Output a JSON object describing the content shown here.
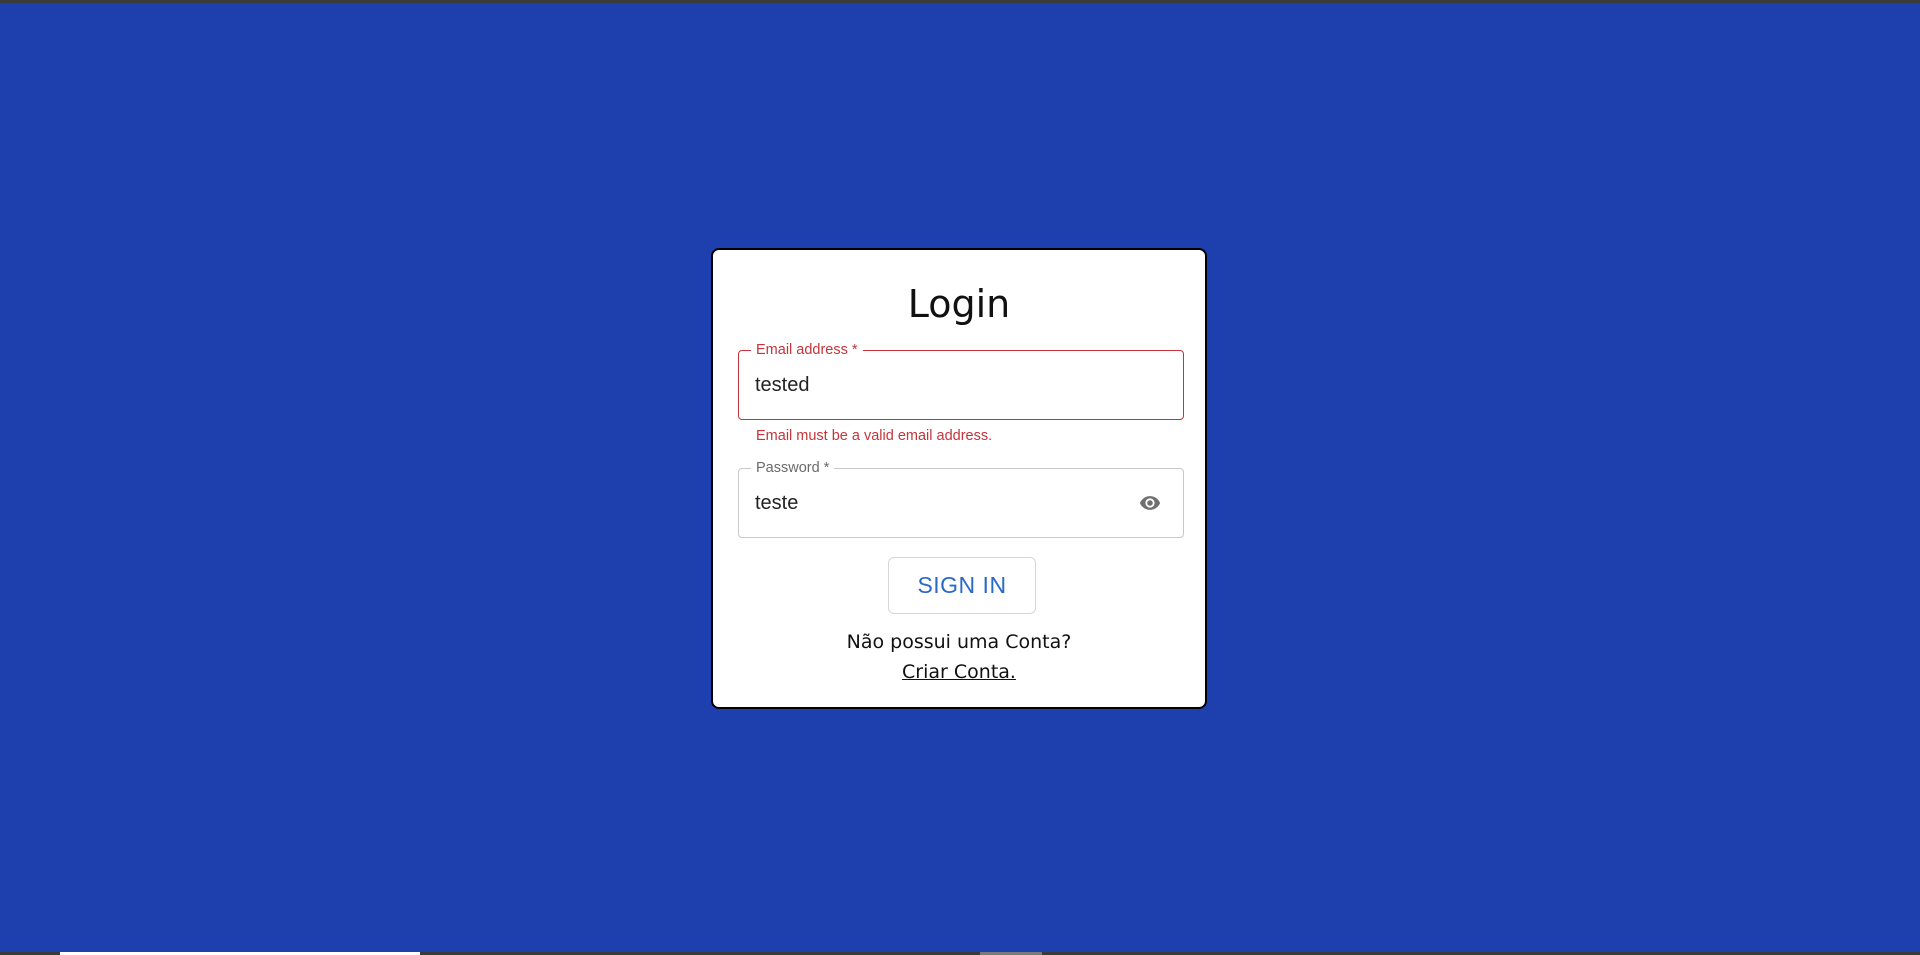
{
  "colors": {
    "background": "#1e40af",
    "card": "#ffffff",
    "error": "#c4343a",
    "button_text": "#2a69c7"
  },
  "login": {
    "title": "Login",
    "email": {
      "label": "Email address *",
      "value": "tested",
      "error": "Email must be a valid email address."
    },
    "password": {
      "label": "Password *",
      "value": "teste",
      "toggle_icon": "eye-icon"
    },
    "signin_label": "SIGN IN",
    "no_account_text": "Não possui uma Conta?",
    "create_account_link": "Criar Conta."
  }
}
